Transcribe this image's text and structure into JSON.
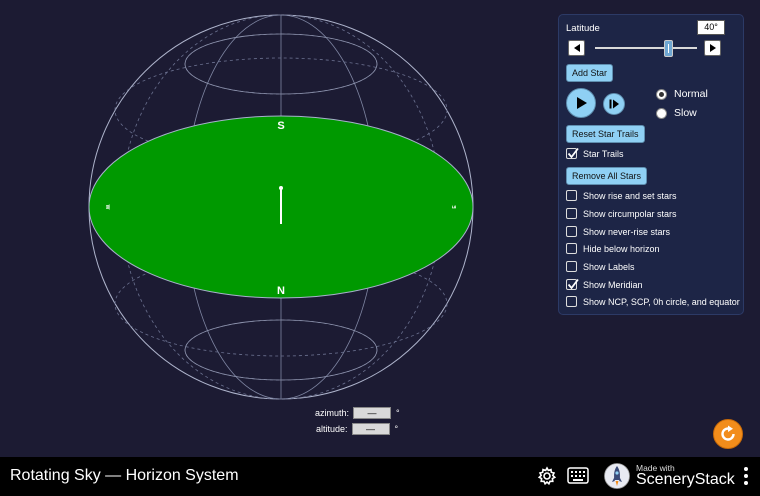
{
  "app": {
    "title": "Rotating Sky — Horizon System"
  },
  "horizon": {
    "compass_s": "S",
    "compass_n": "N",
    "compass_w": "W",
    "compass_e": "E",
    "ground_color": "#009900"
  },
  "panel": {
    "latitude_label": "Latitude",
    "latitude_value": "40°",
    "latitude_level": 40,
    "add_star": "Add Star",
    "speed_options": [
      {
        "label": "Normal",
        "selected": true
      },
      {
        "label": "Slow",
        "selected": false
      }
    ],
    "reset_trails": "Reset Star Trails",
    "star_trails": {
      "label": "Star Trails",
      "checked": true
    },
    "remove_all": "Remove All Stars",
    "checkboxes": [
      {
        "label": "Show rise and set stars",
        "checked": false
      },
      {
        "label": "Show circumpolar stars",
        "checked": false
      },
      {
        "label": "Show never-rise stars",
        "checked": false
      },
      {
        "label": "Hide below horizon",
        "checked": false
      },
      {
        "label": "Show Labels",
        "checked": false
      },
      {
        "label": "Show Meridian",
        "checked": true
      },
      {
        "label": "Show NCP, SCP, 0h circle, and equator",
        "checked": false
      }
    ]
  },
  "readouts": {
    "azimuth_label": "azimuth:",
    "azimuth_value": "—",
    "altitude_label": "altitude:",
    "altitude_value": "—",
    "unit": "°"
  },
  "navbar": {
    "made_with": "Made with",
    "brand": "SceneryStack"
  },
  "colors": {
    "accent": "#8fd0f4",
    "background": "#1c1b33",
    "reset": "#f28d1b"
  }
}
